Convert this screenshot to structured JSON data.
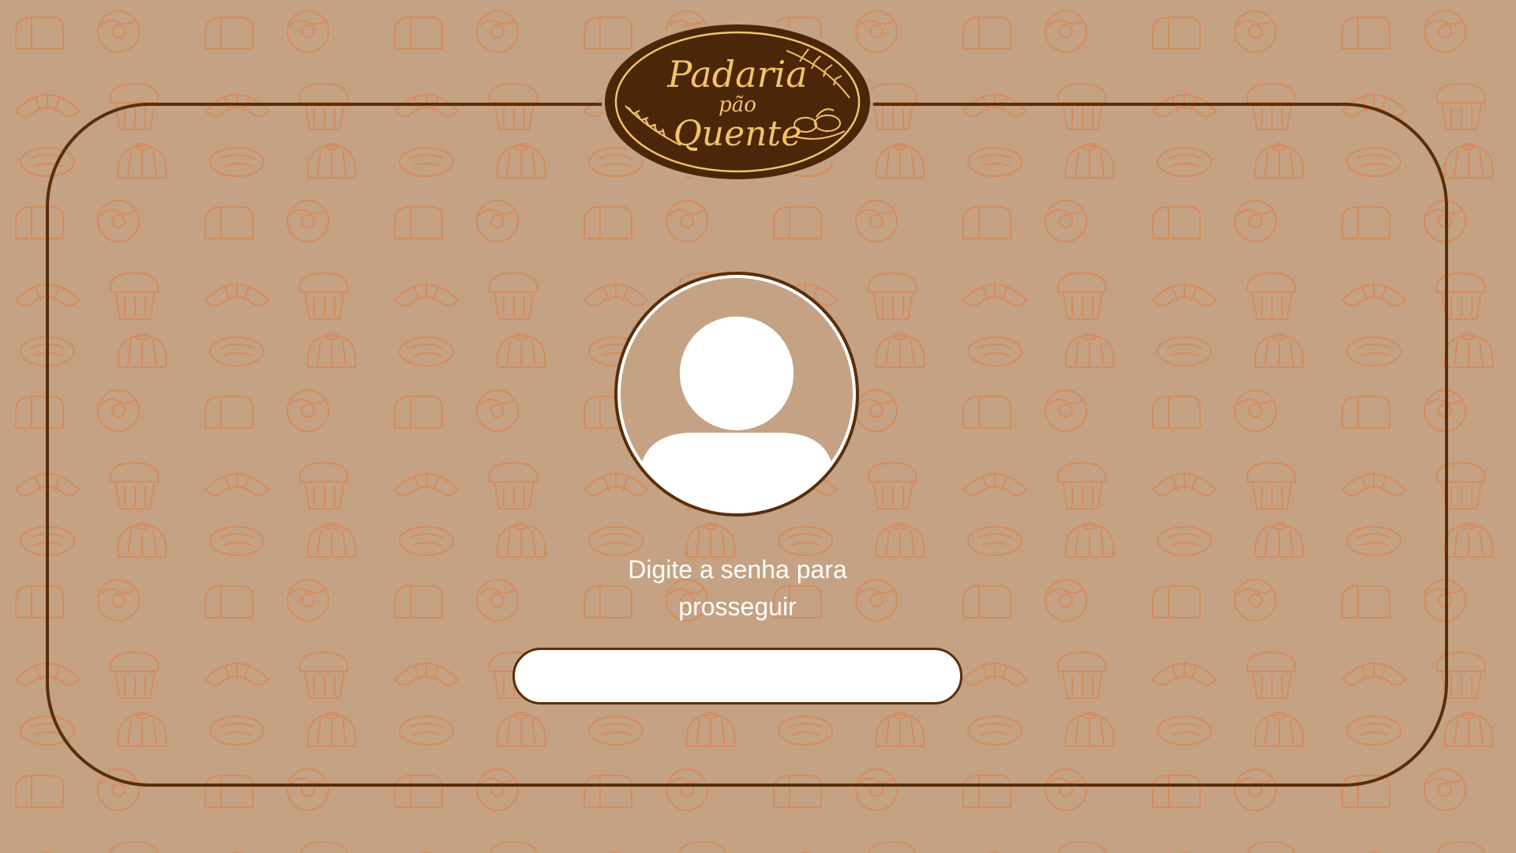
{
  "brand": {
    "line1": "Padaria",
    "line2": "pão",
    "line3": "Quente"
  },
  "login": {
    "prompt": "Digite a senha para prosseguir",
    "password_value": "",
    "password_placeholder": ""
  },
  "colors": {
    "background": "#c4a283",
    "pattern_stroke": "#d9895a",
    "frame": "#5a2e0a",
    "logo_fill": "#4b2608",
    "logo_gold": "#f2c36b",
    "text": "#ffffff"
  },
  "icons": {
    "background_pattern": "bakery-items-pattern",
    "avatar": "user-silhouette-icon",
    "logo_decor": [
      "wheat-icon",
      "bread-basket-icon"
    ]
  }
}
